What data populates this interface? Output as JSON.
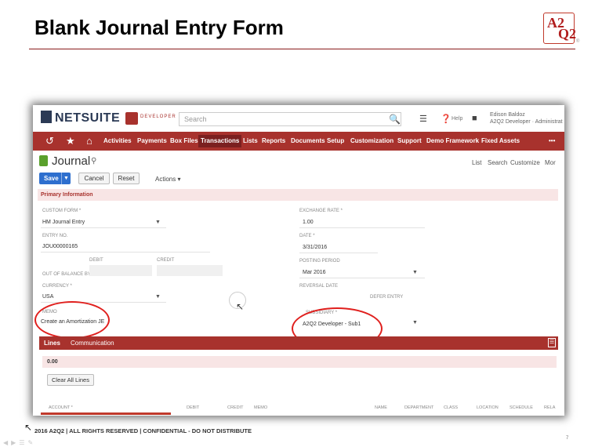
{
  "slide": {
    "title": "Blank Journal Entry Form",
    "logo_top": "A2",
    "logo_bottom": "Q2",
    "logo_mark": "®",
    "footer": "2016 A2Q2 | ALL RIGHTS RESERVED  | CONFIDENTIAL   - DO NOT DISTRIBUTE",
    "page_number": "7"
  },
  "app": {
    "brand": "NETSUITE",
    "developer_badge": "DEVELOPER",
    "search_placeholder": "Search",
    "help_label": "Help",
    "user_name": "Edison Baldoz",
    "user_role": "A2Q2 Developer · Administrat"
  },
  "nav": {
    "items": [
      "Activities",
      "Payments",
      "Box Files",
      "Transactions",
      "Lists",
      "Reports",
      "Documents",
      "Setup",
      "Customization",
      "Support",
      "Demo Framework",
      "Fixed Assets"
    ],
    "more": "•••",
    "active": "Transactions"
  },
  "page": {
    "title": "Journal",
    "right_links": [
      "List",
      "Search",
      "Customize",
      "Mor"
    ]
  },
  "buttons": {
    "save": "Save",
    "save_dropdown": "▼",
    "cancel": "Cancel",
    "reset": "Reset",
    "actions": "Actions ▾"
  },
  "section": {
    "primary_info": "Primary Information"
  },
  "form": {
    "custom_form_label": "CUSTOM FORM *",
    "custom_form_value": "HM Journal Entry",
    "entry_no_label": "ENTRY NO.",
    "entry_no_value": "JOU00000165",
    "debit_label": "DEBIT",
    "credit_label": "CREDIT",
    "out_of_balance_label": "OUT OF BALANCE BY",
    "currency_label": "CURRENCY *",
    "currency_value": "USA",
    "memo_label": "MEMO",
    "memo_value": "Create an Amortization JE",
    "exchange_rate_label": "EXCHANGE RATE *",
    "exchange_rate_value": "1.00",
    "date_label": "DATE *",
    "date_value": "3/31/2016",
    "posting_period_label": "POSTING PERIOD",
    "posting_period_value": "Mar 2016",
    "reversal_date_label": "REVERSAL DATE",
    "defer_entry_label": "DEFER ENTRY",
    "subsidiary_label": "SUBSIDIARY *",
    "subsidiary_value": "A2Q2 Developer - Sub1"
  },
  "lines": {
    "tab_lines": "Lines",
    "tab_communication": "Communication",
    "amount": "0.00",
    "clear_button": "Clear All Lines",
    "columns": [
      "ACCOUNT *",
      "DEBIT",
      "CREDIT",
      "MEMO",
      "NAME",
      "DEPARTMENT",
      "CLASS",
      "LOCATION",
      "SCHEDULE",
      "RELA"
    ]
  }
}
